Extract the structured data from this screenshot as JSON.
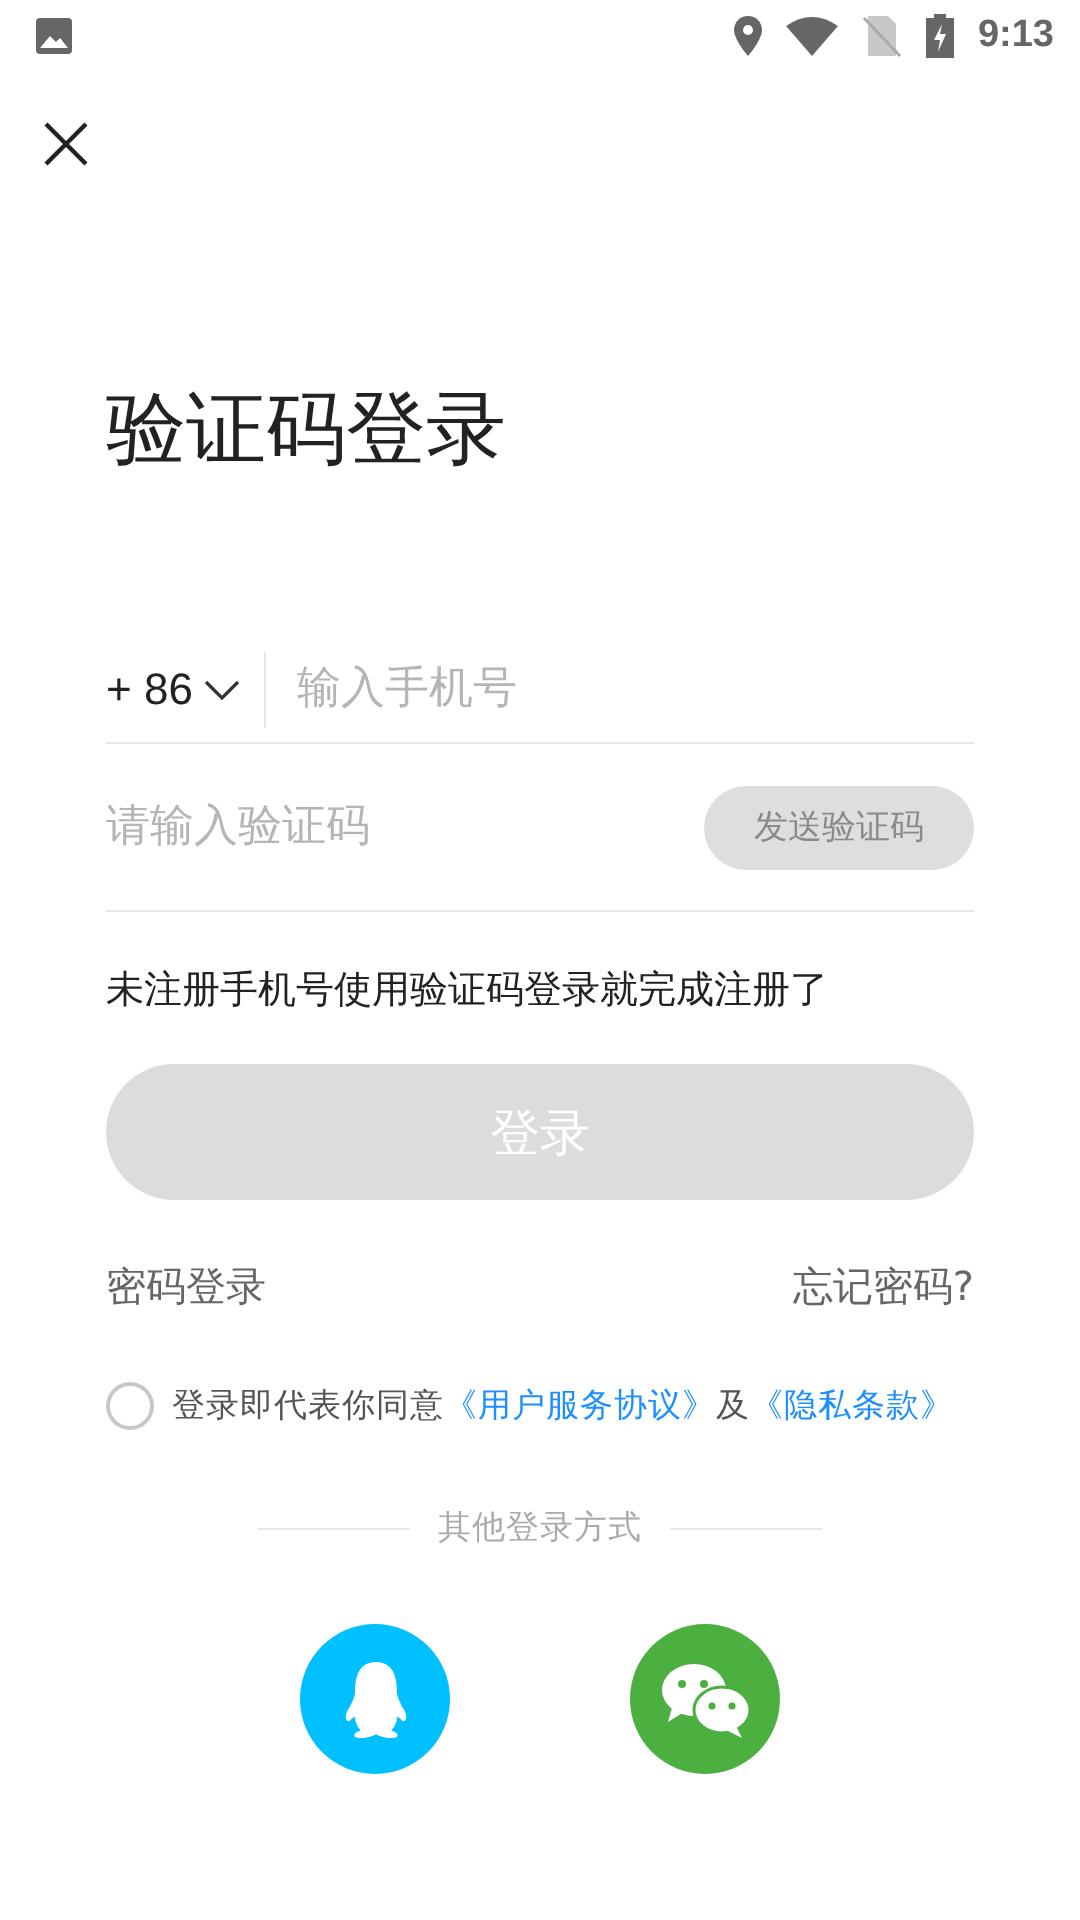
{
  "status_bar": {
    "time": "9:13"
  },
  "title": "验证码登录",
  "phone": {
    "country_code": "+ 86",
    "placeholder": "输入手机号"
  },
  "code": {
    "placeholder": "请输入验证码",
    "send_button": {
      "label": "发送验证码",
      "disabled": true
    }
  },
  "hint": "未注册手机号使用验证码登录就完成注册了",
  "login_button": {
    "label": "登录",
    "disabled": true
  },
  "password_login": "密码登录",
  "forgot_password": "忘记密码?",
  "agreement": {
    "checked": false,
    "parts": [
      {
        "kind": "text",
        "text": "登录即代表你同意"
      },
      {
        "kind": "link",
        "text": "《用户服务协议》"
      },
      {
        "kind": "text",
        "text": "及"
      },
      {
        "kind": "link",
        "text": "《隐私条款》"
      }
    ]
  },
  "other_login": {
    "label": "其他登录方式",
    "providers": [
      {
        "kind": "qq"
      },
      {
        "kind": "wechat"
      }
    ]
  }
}
